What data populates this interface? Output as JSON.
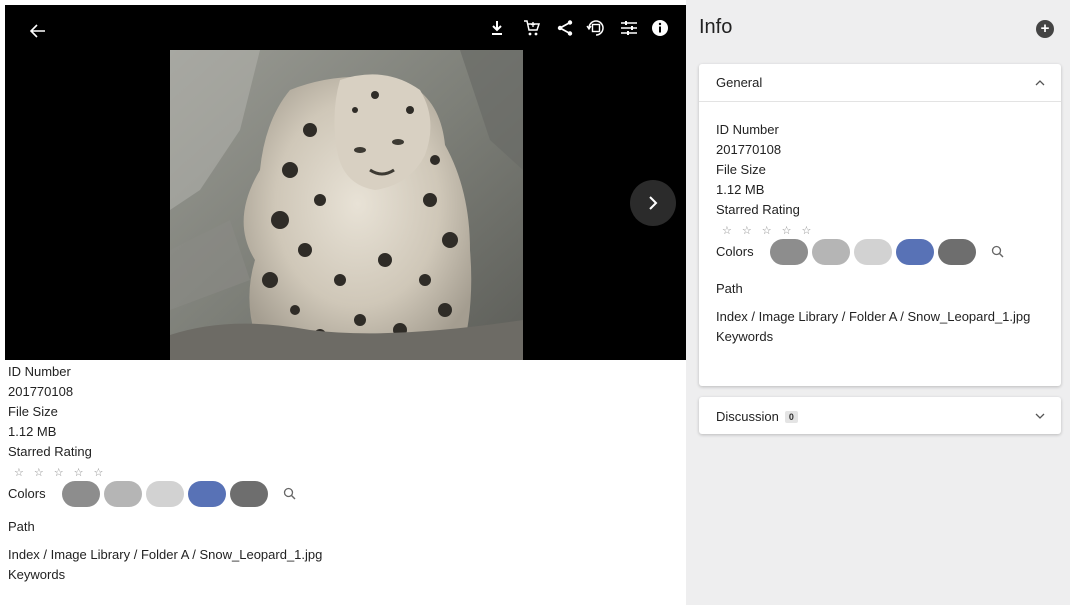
{
  "toolbar": {
    "icons": [
      "back-arrow-icon",
      "download-icon",
      "cart-icon",
      "share-icon",
      "rotate-icon",
      "adjust-icon",
      "info-icon"
    ]
  },
  "details": {
    "id_label": "ID Number",
    "id_value": "201770108",
    "size_label": "File Size",
    "size_value": "1.12 MB",
    "rating_label": "Starred Rating",
    "rating_value": 0,
    "rating_max": 5,
    "colors_label": "Colors",
    "colors": [
      "#8d8d8d",
      "#b5b5b5",
      "#d2d2d2",
      "#5872b6",
      "#6e6e6e"
    ],
    "path_label": "Path",
    "path_value": "Index / Image Library / Folder A / Snow_Leopard_1.jpg",
    "keywords_label": "Keywords"
  },
  "panel": {
    "title": "Info",
    "general": {
      "header": "General",
      "id_label": "ID Number",
      "id_value": "201770108",
      "size_label": "File Size",
      "size_value": "1.12 MB",
      "rating_label": "Starred Rating",
      "colors_label": "Colors",
      "path_label": "Path",
      "path_value": "Index / Image Library / Folder A / Snow_Leopard_1.jpg",
      "keywords_label": "Keywords"
    },
    "discussion": {
      "header": "Discussion",
      "count": "0"
    }
  }
}
